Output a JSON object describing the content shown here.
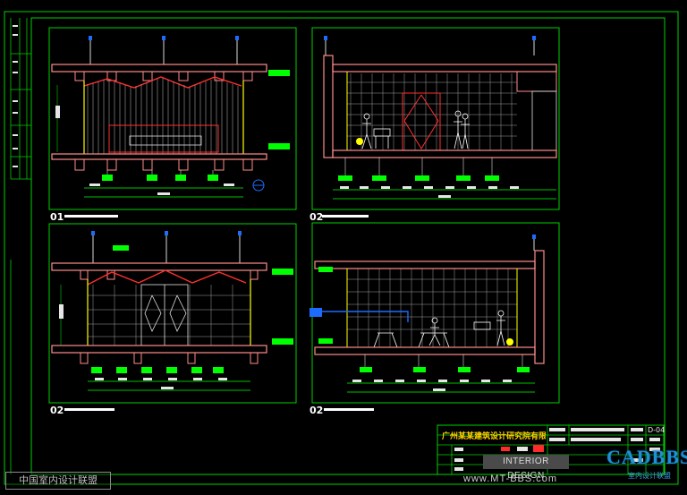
{
  "drawing": {
    "view_labels": [
      "01",
      "02",
      "02",
      "02"
    ],
    "title_block": {
      "company": "广州某某建筑设计研究院有限公司",
      "drawing_code": "D-04"
    }
  },
  "watermarks": {
    "left_stamp": "中国室内设计联盟",
    "bar": "INTERIOR DESIGN",
    "url": "www.MT-BBS.com",
    "brand": "CADBBS",
    "brand_sub": "室内设计联盟"
  },
  "colors": {
    "frame": "#00d000",
    "wall": "#ff8c8c",
    "structure": "#e0e0e0",
    "accent": "#ff2a2a",
    "dimension": "#00ff00",
    "highlight": "#ffff00",
    "blue": "#1e6cff"
  }
}
